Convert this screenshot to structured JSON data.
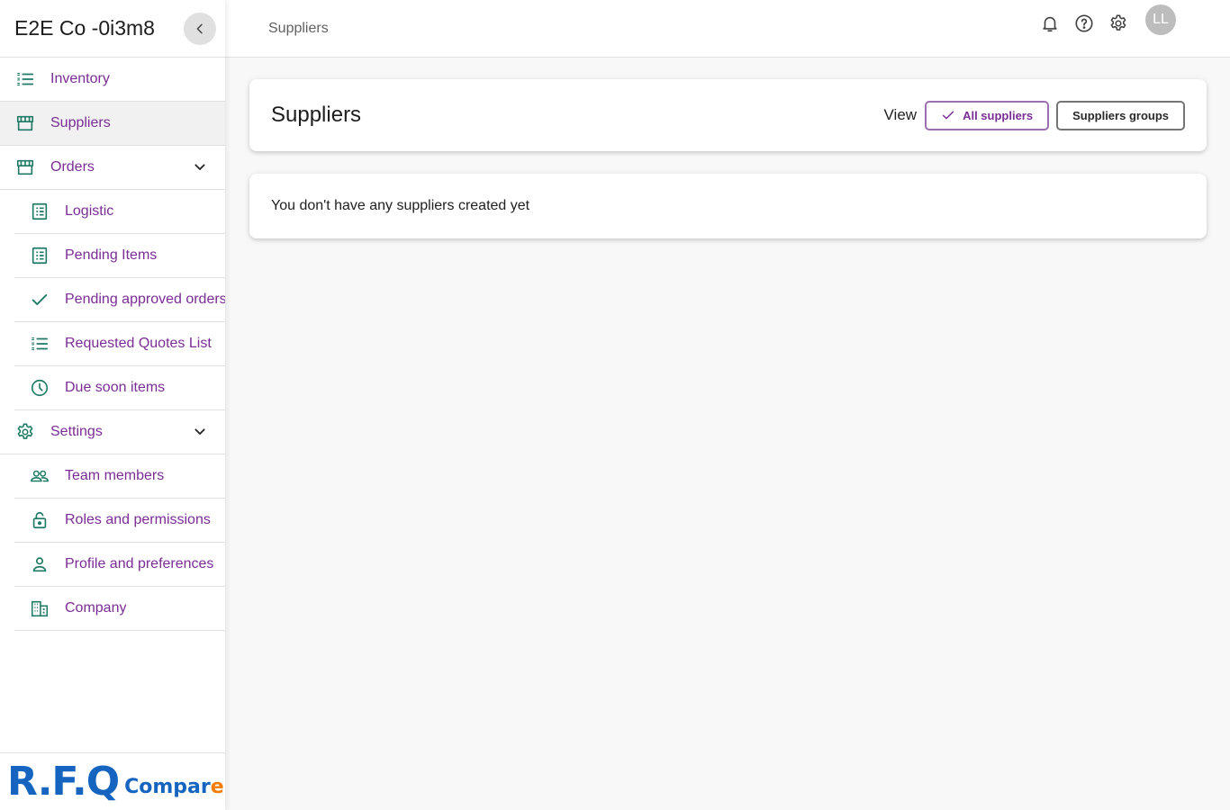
{
  "sidebar": {
    "company_name": "E2E Co -0i3m8",
    "items": [
      {
        "label": "Inventory"
      },
      {
        "label": "Suppliers"
      },
      {
        "label": "Orders"
      },
      {
        "label": "Logistic"
      },
      {
        "label": "Pending Items"
      },
      {
        "label": "Pending approved orders"
      },
      {
        "label": "Requested Quotes List"
      },
      {
        "label": "Due soon items"
      },
      {
        "label": "Settings"
      },
      {
        "label": "Team members"
      },
      {
        "label": "Roles and permissions"
      },
      {
        "label": "Profile and preferences"
      },
      {
        "label": "Company"
      }
    ],
    "logo": {
      "main": "R.F.Q",
      "secondary_a": "Compar",
      "secondary_b": "e"
    }
  },
  "topbar": {
    "breadcrumb": "Suppliers",
    "avatar_initials": "LL",
    "icons": [
      "bell-icon",
      "help-icon",
      "gear-icon"
    ]
  },
  "main": {
    "title": "Suppliers",
    "view_label": "View",
    "view_options": [
      {
        "label": "All suppliers",
        "selected": true
      },
      {
        "label": "Suppliers groups",
        "selected": false
      }
    ],
    "empty_message": "You don't have any suppliers created yet"
  },
  "colors": {
    "accent": "#7a2d95",
    "icon_teal": "#1f7a66",
    "logo_blue": "#1565c0",
    "logo_orange": "#f57c00"
  }
}
